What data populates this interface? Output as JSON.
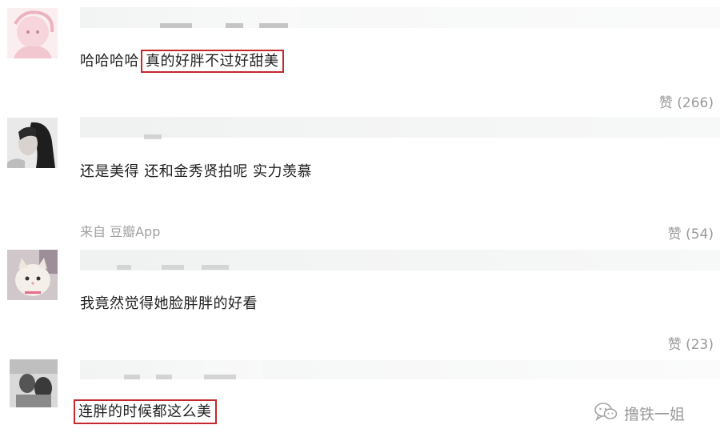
{
  "comments": [
    {
      "avatar": "pink-cartoon-avatar",
      "text_pre": "哈哈哈哈",
      "text_highlight": "真的好胖不过好甜美",
      "likes": "赞 (266)"
    },
    {
      "avatar": "dark-hair-woman-avatar",
      "text": "还是美得 还和金秀贤拍呢 实力羡慕",
      "source": "来自 豆瓣App",
      "likes": "赞 (54)"
    },
    {
      "avatar": "white-cat-avatar",
      "text": "我竟然觉得她脸胖胖的好看",
      "likes": "赞 (23)"
    },
    {
      "avatar": "grayscale-photo-avatar",
      "text_highlight": "连胖的时候都这么美"
    }
  ],
  "watermark": {
    "text": "撸铁一姐",
    "icon": "wechat-icon"
  },
  "colors": {
    "highlight_border": "#c4272d",
    "muted_text": "#999999"
  }
}
